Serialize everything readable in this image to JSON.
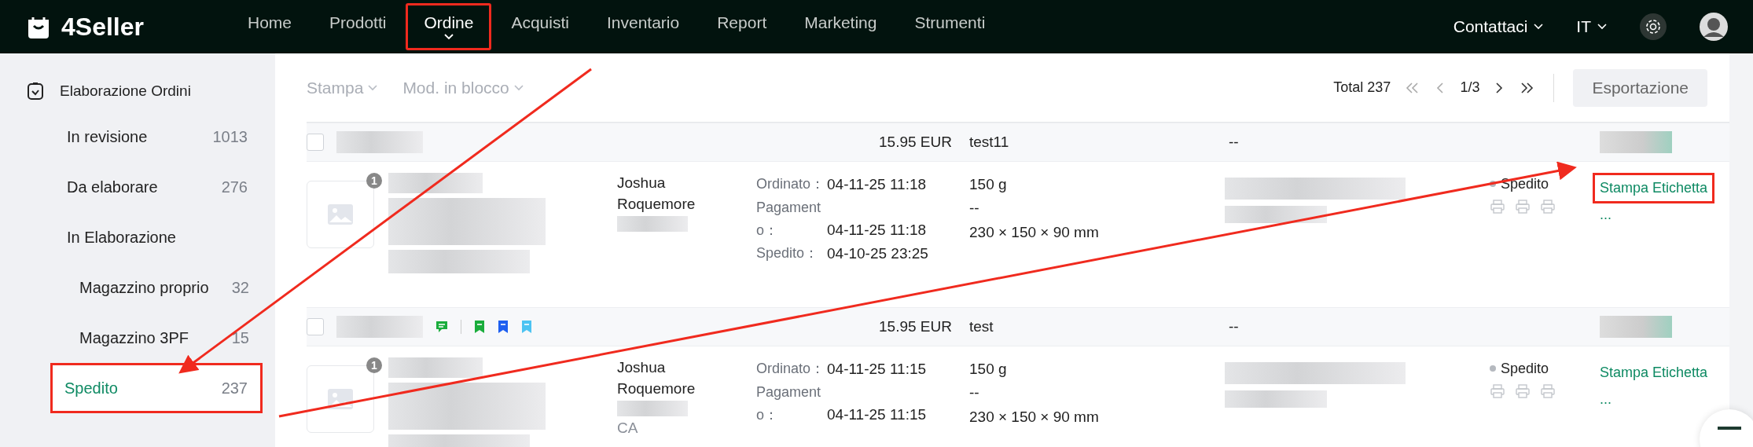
{
  "topbar": {
    "logo": "4Seller",
    "nav": [
      {
        "label": "Home",
        "selected": false,
        "highlighted": false
      },
      {
        "label": "Prodotti",
        "selected": false,
        "highlighted": false
      },
      {
        "label": "Ordine",
        "selected": true,
        "highlighted": true
      },
      {
        "label": "Acquisti",
        "selected": false,
        "highlighted": false
      },
      {
        "label": "Inventario",
        "selected": false,
        "highlighted": false
      },
      {
        "label": "Report",
        "selected": false,
        "highlighted": false
      },
      {
        "label": "Marketing",
        "selected": false,
        "highlighted": false
      },
      {
        "label": "Strumenti",
        "selected": false,
        "highlighted": false
      }
    ],
    "contact": "Contattaci",
    "language": "IT"
  },
  "sidebar": {
    "title": "Elaborazione Ordini",
    "items": [
      {
        "label": "In revisione",
        "count": "1013",
        "selected": false,
        "highlighted": false
      },
      {
        "label": "Da elaborare",
        "count": "276",
        "selected": false,
        "highlighted": false
      },
      {
        "label": "In Elaborazione",
        "selected": false,
        "highlighted": false,
        "children": [
          {
            "label": "Magazzino proprio",
            "count": "32",
            "selected": false,
            "highlighted": false
          },
          {
            "label": "Magazzino 3PF",
            "count": "15",
            "selected": false,
            "highlighted": false
          }
        ]
      },
      {
        "label": "Spedito",
        "count": "237",
        "selected": true,
        "highlighted": true
      }
    ]
  },
  "toolbar": {
    "menus": [
      "Stampa",
      "Mod. in blocco"
    ],
    "total": "Total 237",
    "page": "1/3",
    "export": "Esportazione"
  },
  "orders": [
    {
      "checked": false,
      "amount": "15.95 EUR",
      "note": "test11",
      "column_5": "--",
      "badge": "1",
      "customer": "Joshua Roquemore",
      "dates": [
        {
          "label": "Ordinato：",
          "value": "04-11-25 11:18"
        },
        {
          "label": "Pagamento：",
          "value": "04-11-25 11:18"
        },
        {
          "label": "Spedito：",
          "value": "04-10-25 23:25"
        }
      ],
      "weight": "150 g",
      "dash": "--",
      "dimensions": "230 × 150 × 90 mm",
      "status": "Spedito",
      "action": "Stampa Etichetta",
      "more": "...",
      "action_highlighted": true
    },
    {
      "checked": false,
      "tags": [
        {
          "kind": "message",
          "color": "#1aad3c"
        },
        {
          "kind": "bookmark",
          "color": "#1aad3c"
        },
        {
          "kind": "bookmark",
          "color": "#1e5ff0"
        },
        {
          "kind": "bookmark",
          "color": "#4cc3f2"
        }
      ],
      "amount": "15.95 EUR",
      "note": "test",
      "column_5": "--",
      "badge": "1",
      "customer": "Joshua Roquemore",
      "region": "CA",
      "dates": [
        {
          "label": "Ordinato：",
          "value": "04-11-25 11:15"
        },
        {
          "label": "Pagamento：",
          "value": "04-11-25 11:15"
        }
      ],
      "weight": "150 g",
      "dash": "--",
      "dimensions": "230 × 150 × 90 mm",
      "status": "Spedito",
      "action": "Stampa Etichetta",
      "more": "...",
      "action_highlighted": false
    }
  ]
}
